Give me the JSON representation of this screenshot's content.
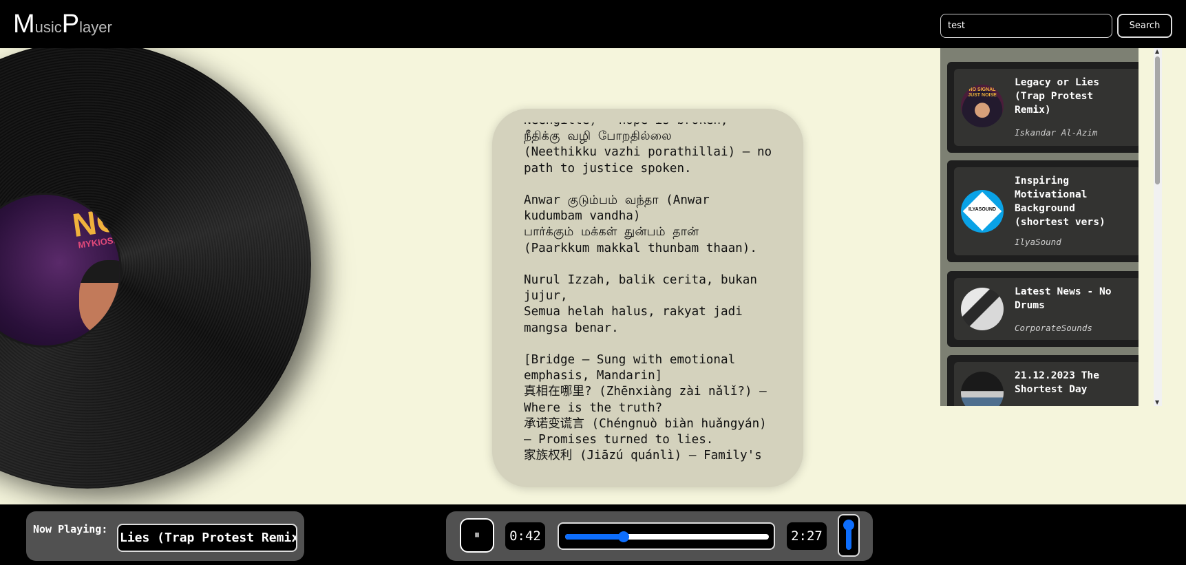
{
  "app": {
    "title_big_1": "M",
    "title_small_1": "usic",
    "title_big_2": "P",
    "title_small_2": "layer"
  },
  "search": {
    "value": "test",
    "button_label": "Search"
  },
  "album_art": {
    "title": "NOISE",
    "subtitle": "MYKIOSK MADAN"
  },
  "lyrics": {
    "text": "Neengitte) — hope is broken,\nநீதிக்கு வழி போறதில்லை\n(Neethikku vazhi porathillai) — no\npath to justice spoken.\n\nAnwar குடும்பம் வந்தா (Anwar\nkudumbam vandha)\nபார்க்கும் மக்கள் துன்பம் தான்\n(Paarkkum makkal thunbam thaan).\n\nNurul Izzah, balik cerita, bukan\njujur,\nSemua helah halus, rakyat jadi\nmangsa benar.\n\n[Bridge – Sung with emotional\nemphasis, Mandarin]\n真相在哪里? (Zhēnxiàng zài nǎlǐ?) —\nWhere is the truth?\n承诺变谎言 (Chéngnuò biàn huǎngyán)\n— Promises turned to lies.\n家族权利 (Jiāzú quánlì) — Family's"
  },
  "playlist": [
    {
      "title": "Legacy or Lies (Trap Protest Remix)",
      "artist": "Iskandar Al-Azim",
      "thumb_text": "NO SIGNAL JUST NOISE"
    },
    {
      "title": "Inspiring Motivational Background (shortest vers)",
      "artist": "IlyaSound",
      "thumb_text": "ILYASOUND"
    },
    {
      "title": "Latest News - No Drums",
      "artist": "CorporateSounds",
      "thumb_text": ""
    },
    {
      "title": "21.12.2023 The Shortest Day",
      "artist": "",
      "thumb_text": ""
    }
  ],
  "player": {
    "now_playing_label": "Now Playing:",
    "now_playing_title": "Lies (Trap Protest Remix)",
    "play_state_icon": "⏸",
    "current_time": "0:42",
    "total_time": "2:27",
    "progress_fraction": 0.286,
    "volume_fraction": 1.0
  },
  "colors": {
    "accent": "#0d6efd",
    "page_bg": "#f5f5dc",
    "lyrics_card": "#d4d2bd",
    "playlist_bg": "#7d8073"
  }
}
